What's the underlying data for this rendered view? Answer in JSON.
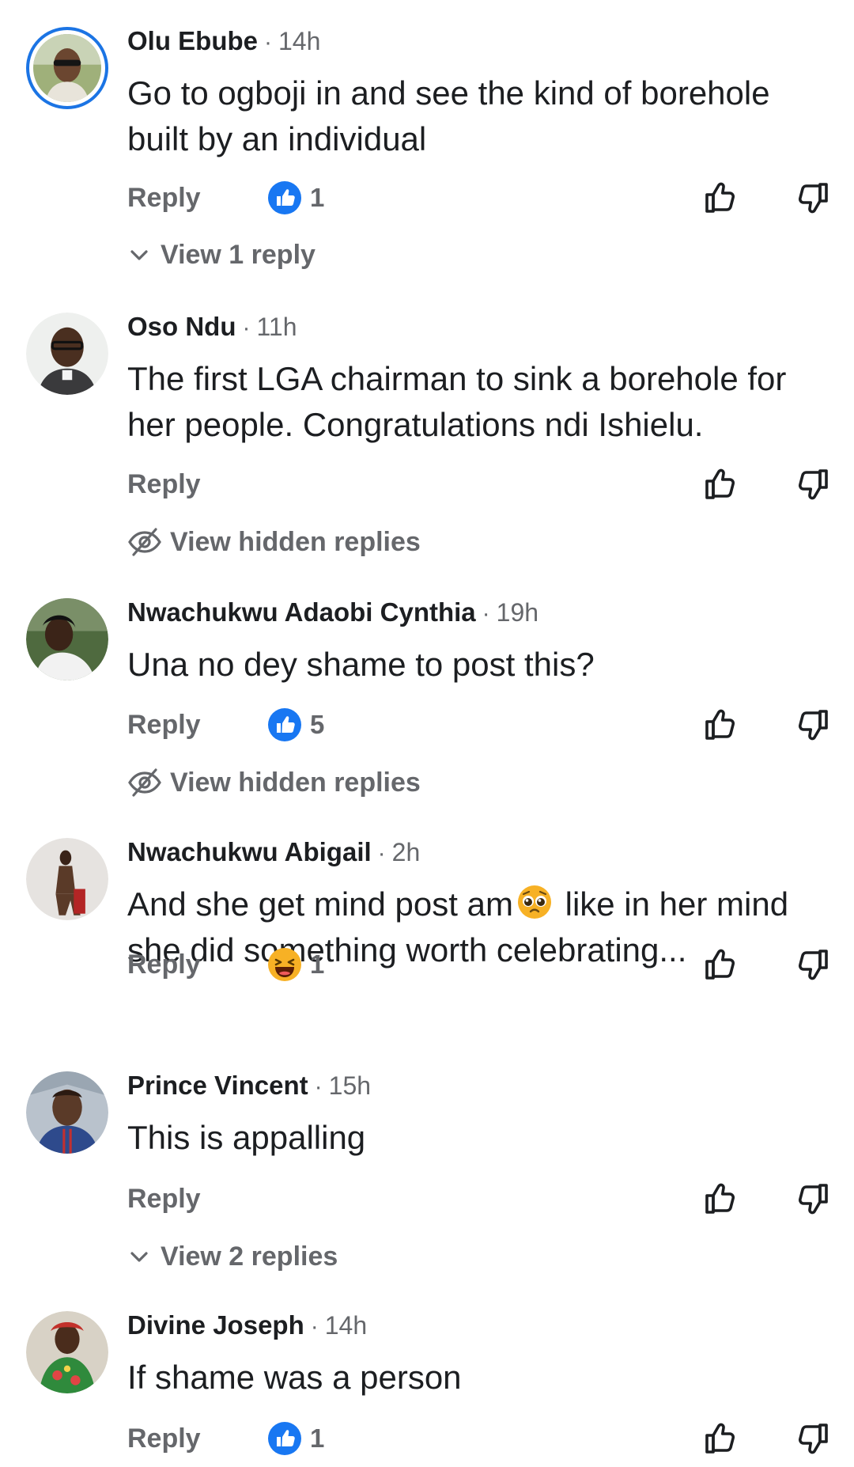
{
  "comments": [
    {
      "author": "Olu Ebube",
      "separator": "·",
      "time": "14h",
      "text": "Go to ogboji in and see the kind of borehole built by an individual",
      "reply_label": "Reply",
      "reaction": {
        "icon": "like-reaction-icon",
        "count": "1"
      },
      "view_replies": "View 1 reply"
    },
    {
      "author": "Oso Ndu",
      "separator": "·",
      "time": "11h",
      "text": "The first LGA chairman to sink a borehole for her people. Congratulations ndi Ishielu.",
      "reply_label": "Reply",
      "view_replies": "View hidden replies"
    },
    {
      "author": "Nwachukwu Adaobi Cynthia",
      "separator": "·",
      "time": "19h",
      "text": "Una no dey shame to post this?",
      "reply_label": "Reply",
      "reaction": {
        "icon": "like-reaction-icon",
        "count": "5"
      },
      "view_replies": "View hidden replies"
    },
    {
      "author": "Nwachukwu Abigail",
      "separator": "·",
      "time": "2h",
      "text_part1": "And she get mind post am",
      "text_emoji": "pleading-face-emoji",
      "text_part2": " like in her mind she did something worth celebrating...",
      "reply_label": "Reply",
      "reaction": {
        "icon": "haha-reaction-icon",
        "count": "1"
      }
    },
    {
      "author": "Prince Vincent",
      "separator": "·",
      "time": "15h",
      "text": "This is appalling",
      "reply_label": "Reply",
      "view_replies": "View 2 replies"
    },
    {
      "author": "Divine Joseph",
      "separator": "·",
      "time": "14h",
      "text": "If shame was a person",
      "reply_label": "Reply",
      "reaction": {
        "icon": "like-reaction-icon",
        "count": "1"
      }
    }
  ],
  "colors": {
    "accent": "#1b74e4",
    "text": "#1c1e21",
    "muted": "#65676b",
    "like": "#1877f2",
    "haha": "#f7b125"
  }
}
